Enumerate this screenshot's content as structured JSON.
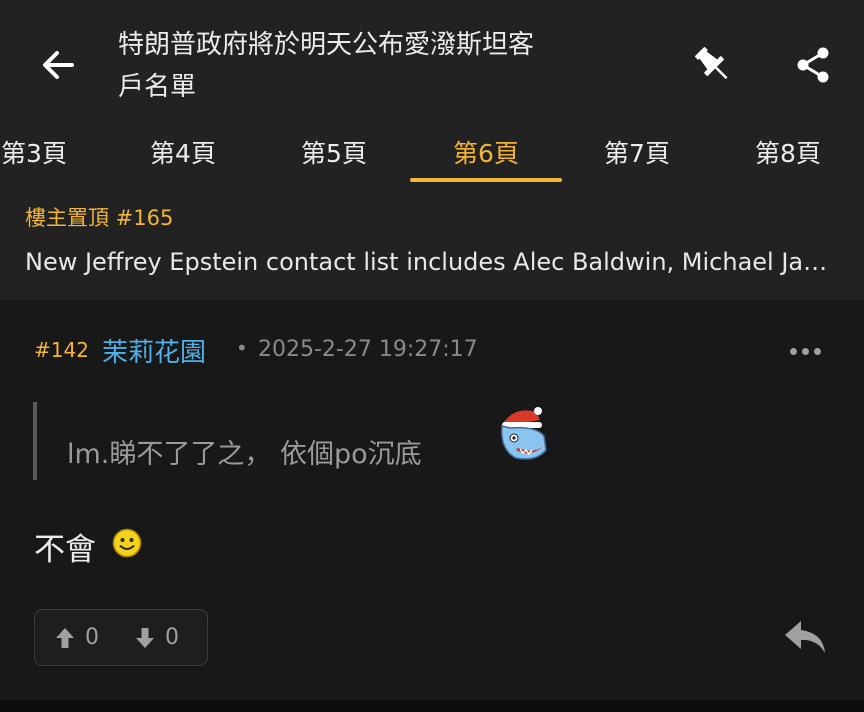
{
  "header": {
    "title_line1": "特朗普政府將於明天公布愛潑斯坦客",
    "title_line2": "戶名單",
    "back_icon": "arrow-left-icon",
    "pin_icon": "pushpin-icon",
    "share_icon": "share-icon"
  },
  "tabs": [
    {
      "label": "第3頁"
    },
    {
      "label": "第4頁"
    },
    {
      "label": "第5頁"
    },
    {
      "label": "第6頁",
      "active": true
    },
    {
      "label": "第7頁"
    },
    {
      "label": "第8頁"
    }
  ],
  "pinned": {
    "label": "樓主置頂 #165",
    "text": "New Jeffrey Epstein contact list includes Alec Baldwin, Michael Jackson"
  },
  "post": {
    "number": "#142",
    "username": "茉莉花園",
    "separator": "•",
    "timestamp": "2025-2-27 19:27:17",
    "quote": "lm.睇不了了之， 依個po沉底",
    "content": "不會",
    "upvotes": "0",
    "downvotes": "0"
  },
  "colors": {
    "accent": "#f2b53a",
    "username": "#4fb0e8",
    "background": "#181818",
    "header": "#222222"
  }
}
